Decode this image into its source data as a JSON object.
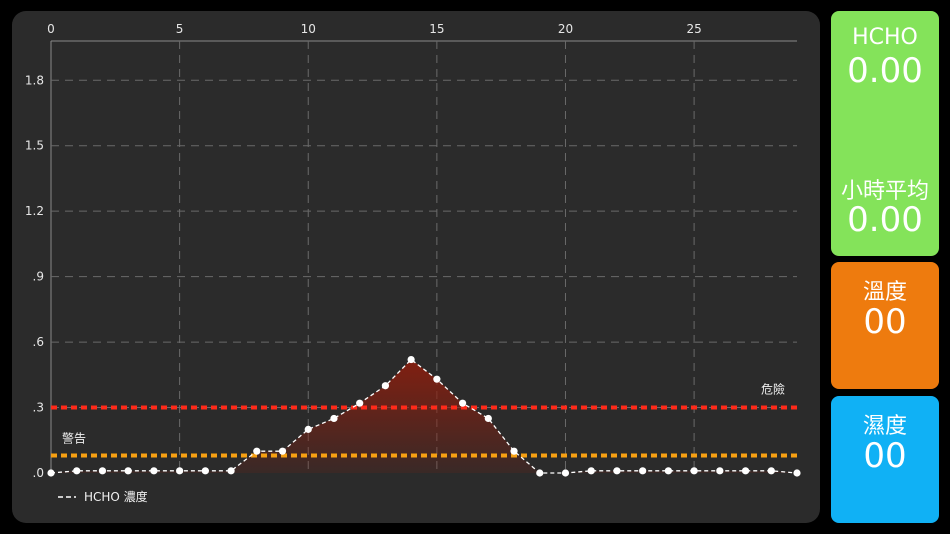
{
  "chart_data": {
    "type": "line",
    "x_ticks": [
      "0",
      "5",
      "10",
      "15",
      "20",
      "25"
    ],
    "y_ticks": [
      ".0",
      ".3",
      ".6",
      ".9",
      "1.2",
      "1.5",
      "1.8"
    ],
    "xlim": [
      0,
      29
    ],
    "ylim": [
      0,
      1.98
    ],
    "x": [
      0,
      1,
      2,
      3,
      4,
      5,
      6,
      7,
      8,
      9,
      10,
      11,
      12,
      13,
      14,
      15,
      16,
      17,
      18,
      19,
      20,
      21,
      22,
      23,
      24,
      25,
      26,
      27,
      28,
      29
    ],
    "series": [
      {
        "name": "HCHO 濃度",
        "color": "#ffffff",
        "values": [
          0.0,
          0.01,
          0.01,
          0.01,
          0.01,
          0.01,
          0.01,
          0.01,
          0.1,
          0.1,
          0.2,
          0.25,
          0.32,
          0.4,
          0.52,
          0.43,
          0.32,
          0.25,
          0.1,
          0.0,
          0.0,
          0.01,
          0.01,
          0.01,
          0.01,
          0.01,
          0.01,
          0.01,
          0.01,
          0.0
        ]
      }
    ],
    "thresholds": [
      {
        "label": "危險",
        "value": 0.3,
        "color": "#ff2a1a"
      },
      {
        "label": "警告",
        "value": 0.08,
        "color": "#f7a012"
      }
    ],
    "grid": true,
    "legend": "bottom-left",
    "fill_color": "#8b1e0e"
  },
  "tiles": {
    "hcho": {
      "label": "HCHO",
      "value": "0.00"
    },
    "hourly_avg": {
      "label": "小時平均",
      "value": "0.00"
    },
    "temperature": {
      "label": "溫度",
      "value": "00"
    },
    "humidity": {
      "label": "濕度",
      "value": "00"
    }
  }
}
